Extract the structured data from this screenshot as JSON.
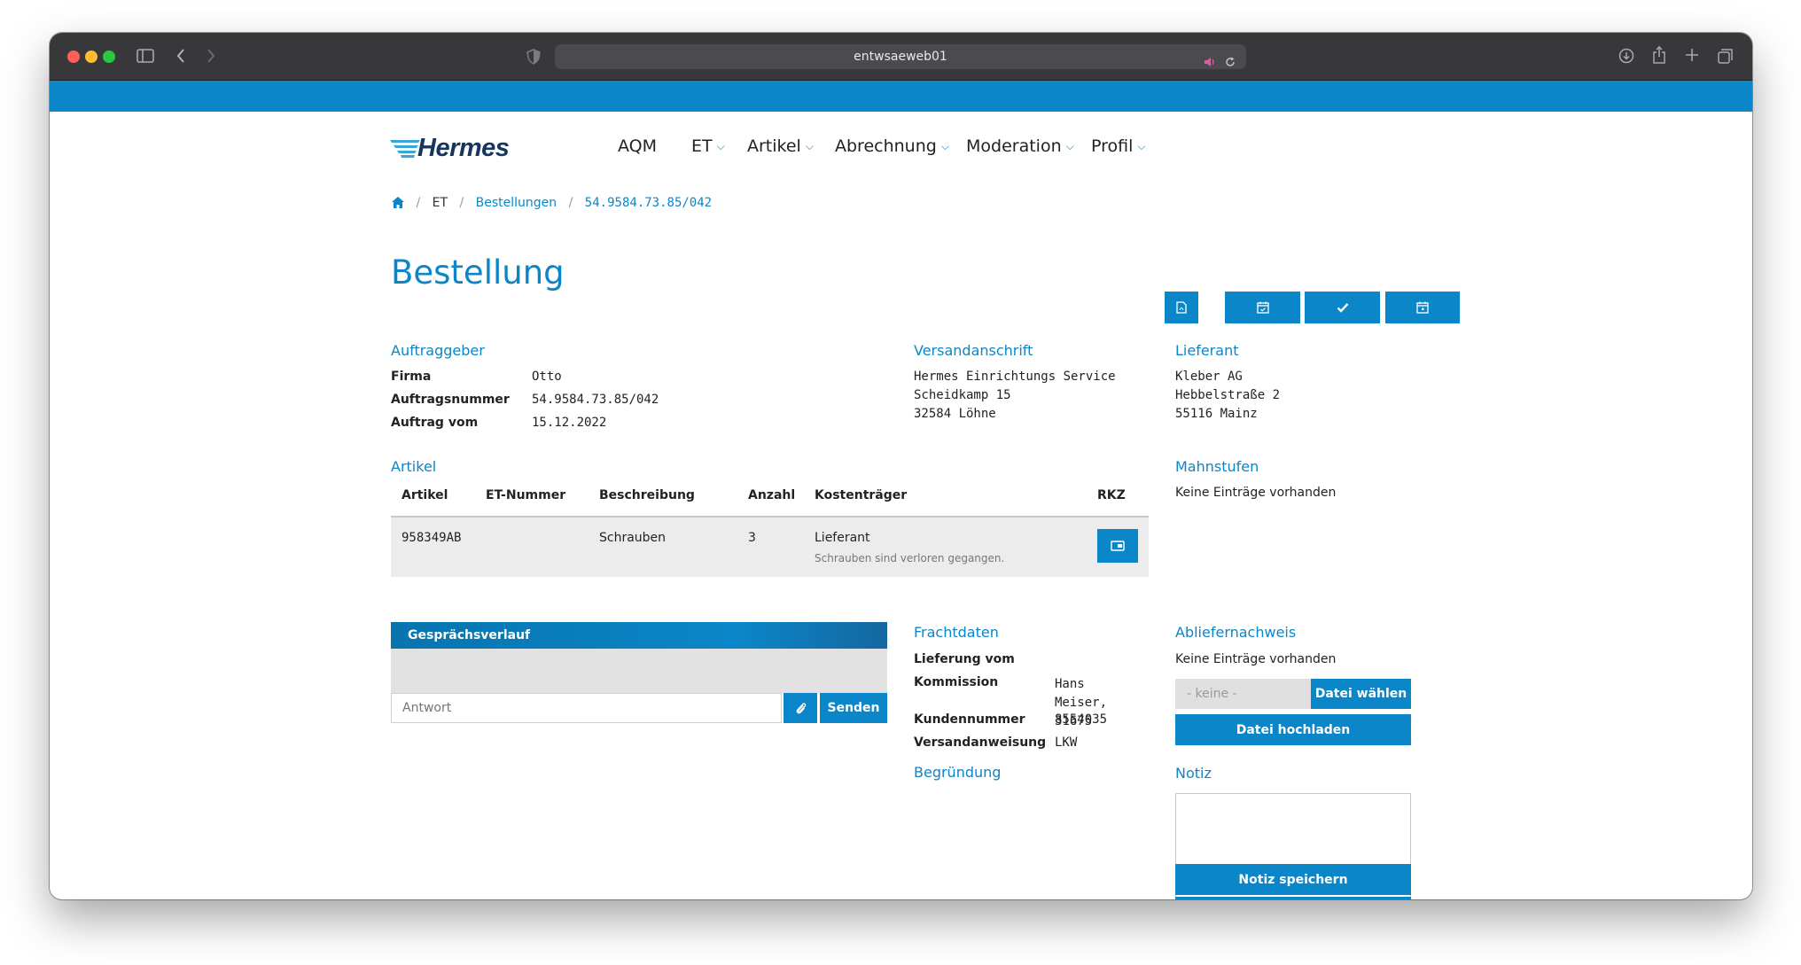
{
  "browser": {
    "url": "entwsaeweb01"
  },
  "logo": {
    "text": "Hermes"
  },
  "nav": [
    {
      "label": "AQM",
      "dropdown": false
    },
    {
      "label": "ET",
      "dropdown": true
    },
    {
      "label": "Artikel",
      "dropdown": true
    },
    {
      "label": "Abrechnung",
      "dropdown": true
    },
    {
      "label": "Moderation",
      "dropdown": true
    },
    {
      "label": "Profil",
      "dropdown": true
    }
  ],
  "breadcrumb": {
    "items": [
      "ET",
      "Bestellungen",
      "54.9584.73.85/042"
    ]
  },
  "page_title": "Bestellung",
  "auftraggeber": {
    "heading": "Auftraggeber",
    "rows": [
      {
        "label": "Firma",
        "value": "Otto"
      },
      {
        "label": "Auftragsnummer",
        "value": "54.9584.73.85/042"
      },
      {
        "label": "Auftrag vom",
        "value": "15.12.2022"
      }
    ]
  },
  "versandanschrift": {
    "heading": "Versandanschrift",
    "lines": [
      "Hermes Einrichtungs Service",
      "Scheidkamp 15",
      "32584 Löhne"
    ]
  },
  "lieferant": {
    "heading": "Lieferant",
    "lines": [
      "Kleber AG",
      "Hebbelstraße 2",
      "55116 Mainz"
    ]
  },
  "artikel": {
    "heading": "Artikel",
    "columns": [
      "Artikel",
      "ET-Nummer",
      "Beschreibung",
      "Anzahl",
      "Kostenträger",
      "RKZ"
    ],
    "rows": [
      {
        "artikel": "958349AB",
        "et_nummer": "",
        "beschreibung": "Schrauben",
        "anzahl": "3",
        "kostentraeger": "Lieferant",
        "kostentraeger_note": "Schrauben sind verloren gegangen."
      }
    ]
  },
  "mahnstufen": {
    "heading": "Mahnstufen",
    "empty": "Keine Einträge vorhanden"
  },
  "gespraechsverlauf": {
    "heading": "Gesprächsverlauf",
    "input_placeholder": "Antwort",
    "send_label": "Senden"
  },
  "frachtdaten": {
    "heading": "Frachtdaten",
    "rows": [
      {
        "label": "Lieferung vom",
        "value": ""
      },
      {
        "label": "Kommission",
        "value": "Hans Meiser, 31675"
      },
      {
        "label": "Kundennummer",
        "value": "8554035"
      },
      {
        "label": "Versandanweisung",
        "value": "LKW"
      }
    ]
  },
  "begruendung": {
    "heading": "Begründung"
  },
  "abliefernachweis": {
    "heading": "Abliefernachweis",
    "empty": "Keine Einträge vorhanden",
    "file_placeholder": "- keine -",
    "choose_label": "Datei wählen",
    "upload_label": "Datei hochladen"
  },
  "notiz": {
    "heading": "Notiz",
    "save_label": "Notiz speichern"
  },
  "colors": {
    "brand_blue": "#0b86c8",
    "logo_navy": "#16365f",
    "titlebar": "#38383b"
  }
}
